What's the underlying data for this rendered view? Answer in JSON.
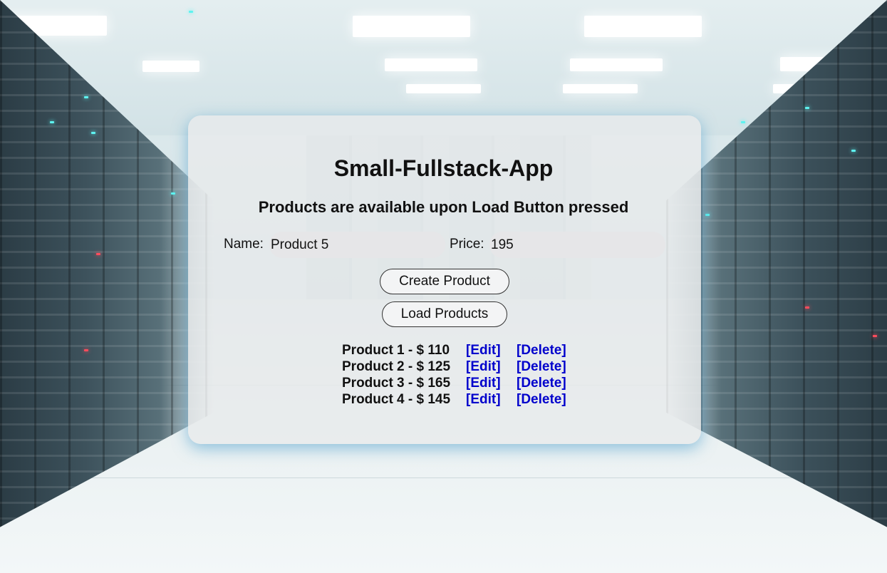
{
  "app": {
    "title": "Small-Fullstack-App",
    "subtitle": "Products are available upon Load Button pressed"
  },
  "form": {
    "name_label": "Name:",
    "name_value": "Product 5",
    "price_label": "Price:",
    "price_value": "195"
  },
  "buttons": {
    "create": "Create Product",
    "load": "Load Products"
  },
  "products": [
    {
      "label": "Product 1 - $ 110",
      "edit": "[Edit]",
      "delete": "[Delete]"
    },
    {
      "label": "Product 2 - $ 125",
      "edit": "[Edit]",
      "delete": "[Delete]"
    },
    {
      "label": "Product 3 - $ 165",
      "edit": "[Edit]",
      "delete": "[Delete]"
    },
    {
      "label": "Product 4 - $ 145",
      "edit": "[Edit]",
      "delete": "[Delete]"
    }
  ],
  "colors": {
    "link": "#0000cc",
    "card_shadow": "#3c96c8",
    "card_bg": "#e8eaec"
  }
}
